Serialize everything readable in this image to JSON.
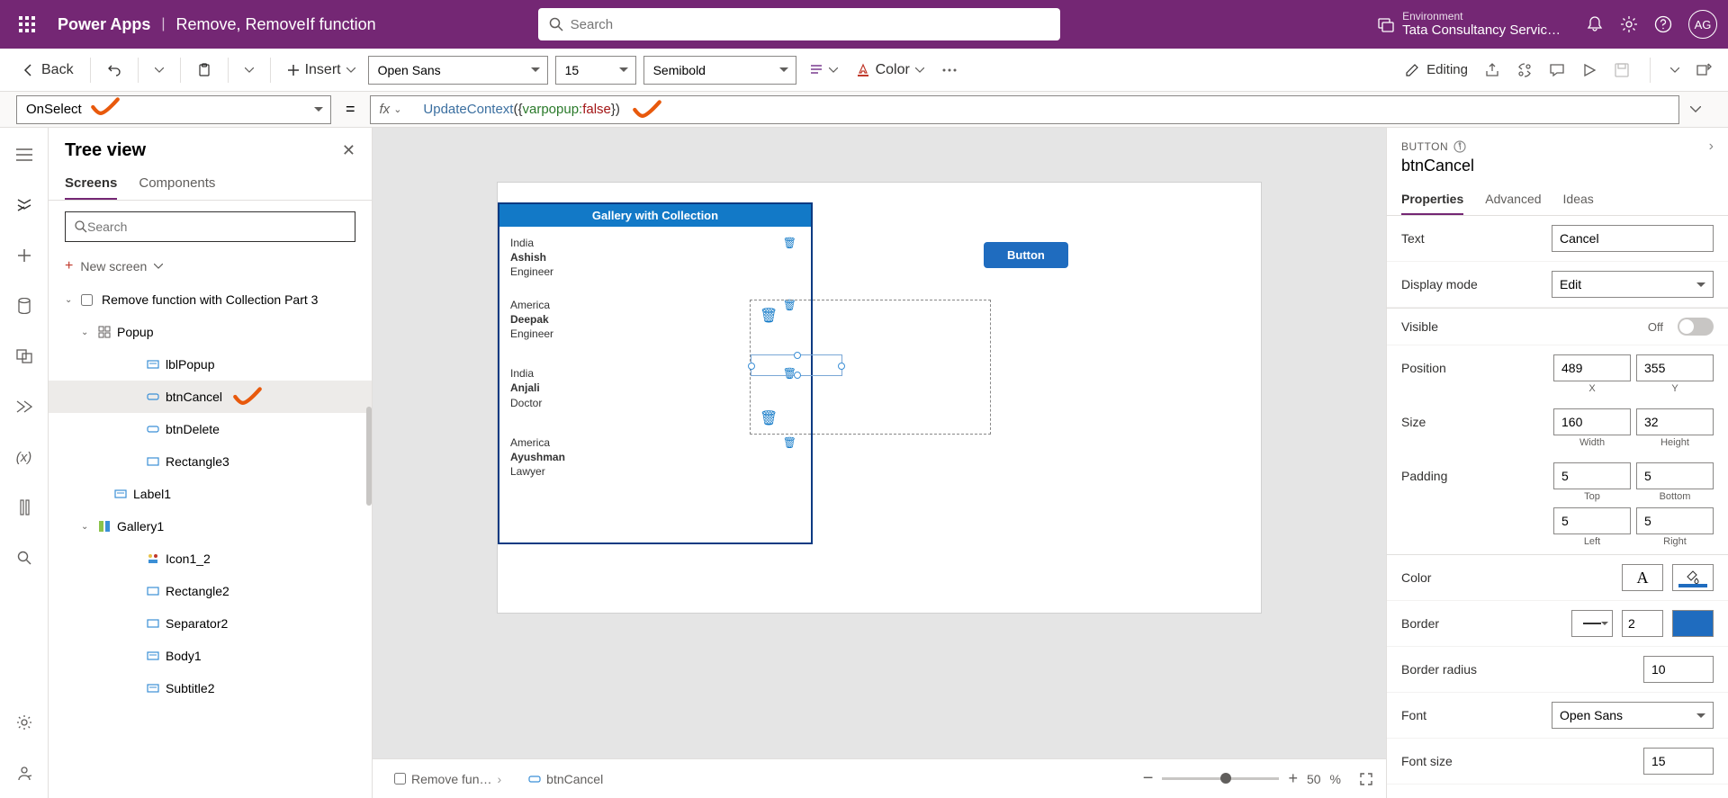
{
  "header": {
    "app": "Power Apps",
    "doc": "Remove, RemoveIf function",
    "search_placeholder": "Search",
    "env_label": "Environment",
    "env_value": "Tata Consultancy Servic…",
    "avatar": "AG"
  },
  "toolbar": {
    "back": "Back",
    "insert": "Insert",
    "font": "Open Sans",
    "font_size": "15",
    "font_weight": "Semibold",
    "color": "Color",
    "editing": "Editing"
  },
  "formula": {
    "property": "OnSelect",
    "fx": "fx",
    "fn": "UpdateContext",
    "paren_open": "(",
    "brace_open": "{",
    "field": "varpopup:",
    "space": " ",
    "bool": "false",
    "brace_close": "}",
    "paren_close": ")"
  },
  "tree": {
    "title": "Tree view",
    "tabs": {
      "screens": "Screens",
      "components": "Components"
    },
    "search_placeholder": "Search",
    "new_screen": "New screen",
    "items": {
      "screen": "Remove function with Collection Part 3",
      "popup": "Popup",
      "lblPopup": "lblPopup",
      "btnCancel": "btnCancel",
      "btnDelete": "btnDelete",
      "rectangle3": "Rectangle3",
      "label1": "Label1",
      "gallery1": "Gallery1",
      "icon1_2": "Icon1_2",
      "rectangle2": "Rectangle2",
      "separator2": "Separator2",
      "body1": "Body1",
      "subtitle2": "Subtitle2"
    }
  },
  "canvas": {
    "gallery_title": "Gallery with Collection",
    "rows": [
      {
        "country": "India",
        "name": "Ashish",
        "role": "Engineer"
      },
      {
        "country": "America",
        "name": "Deepak",
        "role": "Engineer"
      },
      {
        "country": "India",
        "name": "Anjali",
        "role": "Doctor"
      },
      {
        "country": "America",
        "name": "Ayushman",
        "role": "Lawyer"
      }
    ],
    "button": "Button",
    "breadcrumb_screen": "Remove fun…",
    "breadcrumb_ctrl": "btnCancel",
    "zoom": "50",
    "zoom_pct": "%"
  },
  "props": {
    "type": "BUTTON",
    "name": "btnCancel",
    "tabs": {
      "properties": "Properties",
      "advanced": "Advanced",
      "ideas": "Ideas"
    },
    "fields": {
      "text_label": "Text",
      "text_val": "Cancel",
      "display_label": "Display mode",
      "display_val": "Edit",
      "visible_label": "Visible",
      "visible_off": "Off",
      "position_label": "Position",
      "pos_x": "489",
      "pos_y": "355",
      "x": "X",
      "y": "Y",
      "size_label": "Size",
      "size_w": "160",
      "size_h": "32",
      "width": "Width",
      "height": "Height",
      "padding_label": "Padding",
      "pad_t": "5",
      "pad_b": "5",
      "pad_l": "5",
      "pad_r": "5",
      "top": "Top",
      "bottom": "Bottom",
      "left": "Left",
      "right": "Right",
      "color_label": "Color",
      "border_label": "Border",
      "border_w": "2",
      "border_radius_label": "Border radius",
      "border_radius": "10",
      "font_label": "Font",
      "font_val": "Open Sans",
      "font_size_label": "Font size",
      "font_size_val": "15"
    }
  }
}
